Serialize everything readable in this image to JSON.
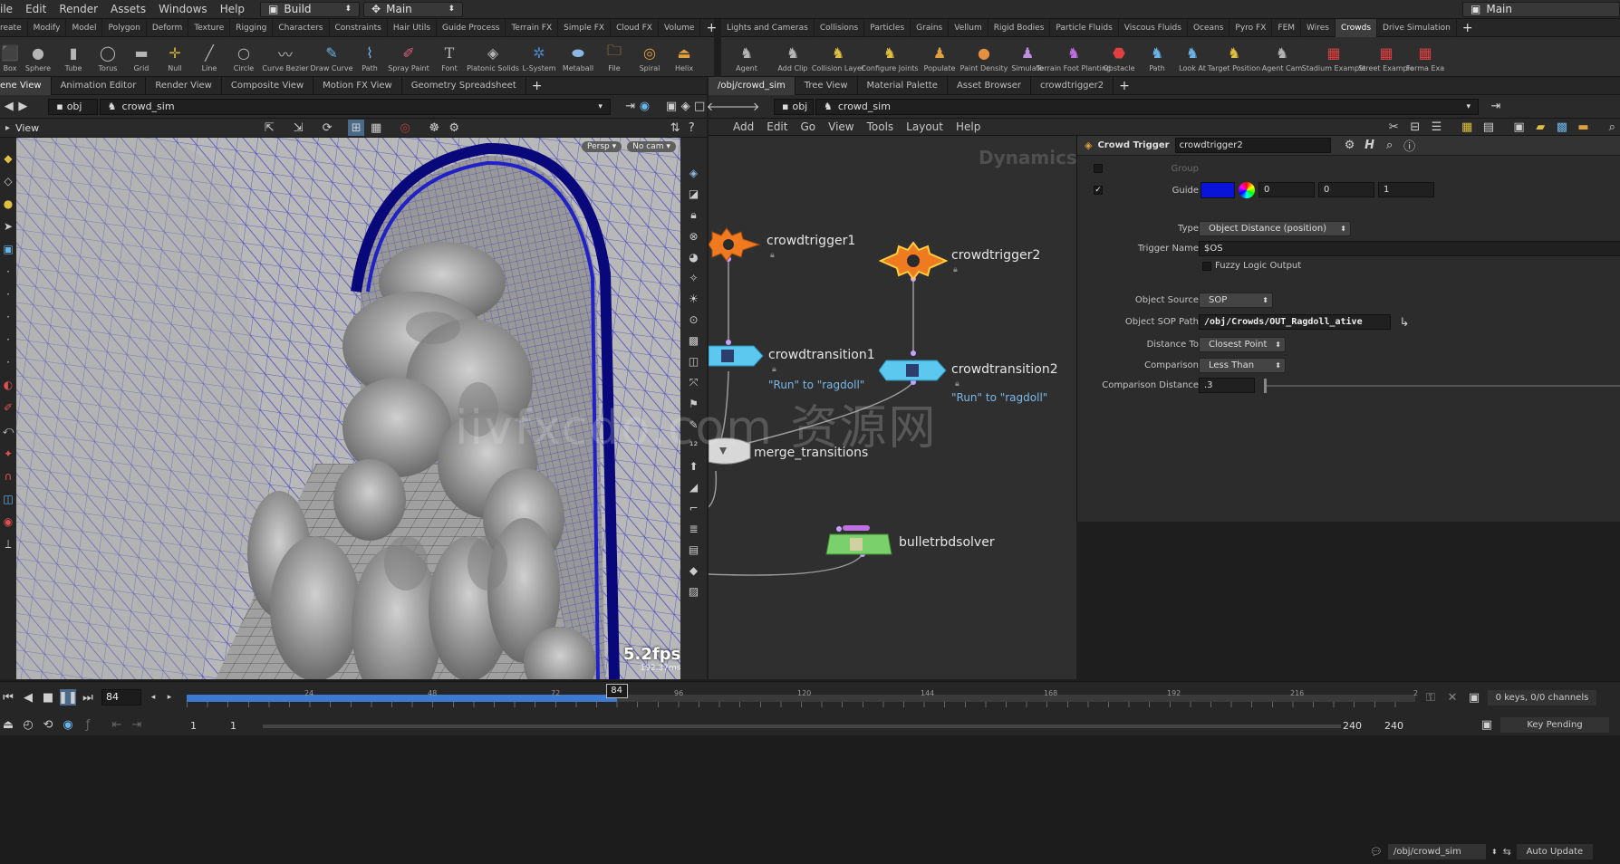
{
  "menubar": {
    "items": [
      "ile",
      "Edit",
      "Render",
      "Assets",
      "Windows",
      "Help"
    ],
    "desktop": "Build",
    "network": "Main",
    "right_desktop": "Main"
  },
  "shelf_left": {
    "tabs": [
      "reate",
      "Modify",
      "Model",
      "Polygon",
      "Deform",
      "Texture",
      "Rigging",
      "Characters",
      "Constraints",
      "Hair Utils",
      "Guide Process",
      "Terrain FX",
      "Simple FX",
      "Cloud FX",
      "Volume"
    ],
    "tools": [
      "Box",
      "Sphere",
      "Tube",
      "Torus",
      "Grid",
      "Null",
      "Line",
      "Circle",
      "Curve Bezier",
      "Draw Curve",
      "Path",
      "Spray Paint",
      "Font",
      "Platonic Solids",
      "L-System",
      "Metaball",
      "File",
      "Spiral",
      "Helix"
    ]
  },
  "shelf_right": {
    "tabs": [
      "Lights and Cameras",
      "Collisions",
      "Particles",
      "Grains",
      "Vellum",
      "Rigid Bodies",
      "Particle Fluids",
      "Viscous Fluids",
      "Oceans",
      "Pyro FX",
      "FEM",
      "Wires",
      "Crowds",
      "Drive Simulation"
    ],
    "tools": [
      "Agent",
      "Add Clip",
      "Collision Layer",
      "Configure Joints",
      "Populate",
      "Paint Density",
      "Simulate",
      "Terrain Foot Planting",
      "Obstacle",
      "Path",
      "Look At",
      "Target Position",
      "Agent Cam",
      "Stadium Example",
      "Street Example",
      "Forma Exa"
    ]
  },
  "left_pane": {
    "tabs": [
      "ene View",
      "Animation Editor",
      "Render View",
      "Composite View",
      "Motion FX View",
      "Geometry Spreadsheet"
    ],
    "path_obj": "obj",
    "path_node": "crowd_sim",
    "view_label": "View",
    "persp": "Persp",
    "cam": "No cam",
    "fps": "5.2fps",
    "ms": "192.37ms"
  },
  "right_pane": {
    "tabs": [
      "/obj/crowd_sim",
      "Tree View",
      "Material Palette",
      "Asset Browser",
      "crowdtrigger2"
    ],
    "path_obj": "obj",
    "path_node": "crowd_sim",
    "menus": [
      "Add",
      "Edit",
      "Go",
      "View",
      "Tools",
      "Layout",
      "Help"
    ],
    "context": "Dynamics"
  },
  "network": {
    "nodes": {
      "trigger1": "crowdtrigger1",
      "trigger2": "crowdtrigger2",
      "transition1": "crowdtransition1",
      "transition2": "crowdtransition2",
      "merge": "merge_transitions",
      "solver": "bulletrbdsolver"
    },
    "note1": "\"Run\" to \"ragdoll\"",
    "note2": "\"Run\" to \"ragdoll\""
  },
  "params": {
    "type_label": "Crowd Trigger",
    "node_name": "crowdtrigger2",
    "group_label": "Group",
    "guide_label": "Guide",
    "guide_color": "#0a14d8",
    "guide_r": "0",
    "guide_g": "0",
    "guide_b": "1",
    "type_field_label": "Type",
    "type_value": "Object Distance (position)",
    "trigger_name_label": "Trigger Name",
    "trigger_name_value": "$OS",
    "fuzzy_label": "Fuzzy Logic Output",
    "object_source_label": "Object Source",
    "object_source_value": "SOP",
    "sop_path_label": "Object SOP Path",
    "sop_path_value": "/obj/Crowds/OUT_Ragdoll_ative",
    "distance_to_label": "Distance To",
    "distance_to_value": "Closest Point",
    "comparison_label": "Comparison",
    "comparison_value": "Less Than",
    "comp_distance_label": "Comparison Distance",
    "comp_distance_value": ".3"
  },
  "timeline": {
    "current_frame": "84",
    "marker": "84",
    "ticks": [
      "24",
      "48",
      "72",
      "96",
      "120",
      "144",
      "168",
      "192",
      "216",
      "2"
    ],
    "range_start": "1",
    "range_start2": "1",
    "range_end": "240",
    "range_end2": "240",
    "keys": "0 keys, 0/0 channels",
    "key_pending": "Key Pending",
    "playhead_fraction": 0.35
  },
  "status": {
    "path": "/obj/crowd_sim",
    "auto_update": "Auto Update"
  },
  "watermark": "iivfxcdo.com 资源网"
}
